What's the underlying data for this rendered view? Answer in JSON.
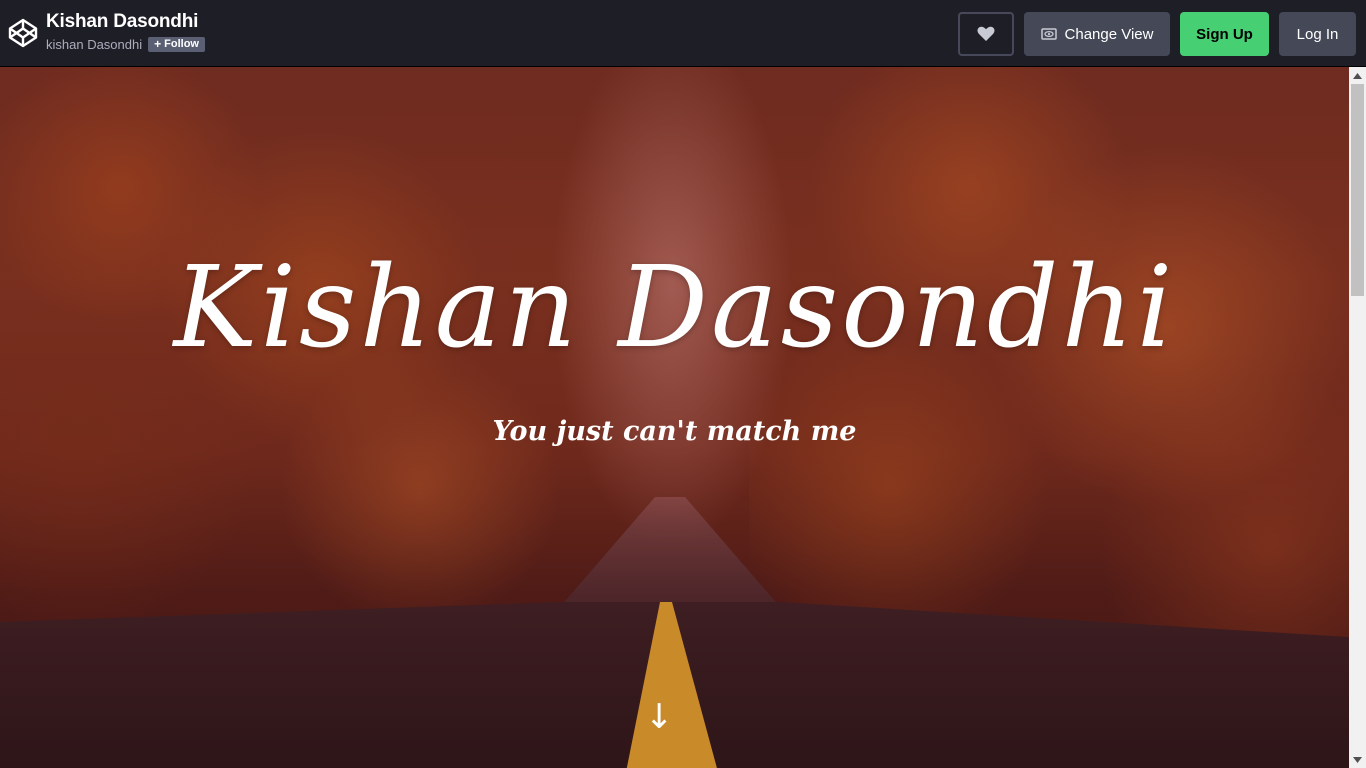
{
  "header": {
    "pen_title": "Kishan Dasondhi",
    "author_name": "kishan Dasondhi",
    "follow_label": "Follow",
    "change_view_label": "Change View",
    "signup_label": "Sign Up",
    "login_label": "Log In"
  },
  "hero": {
    "title": "Kishan Dasondhi",
    "subtitle": "You just can't match me",
    "scroll_arrow": "↓"
  },
  "icons": {
    "logo": "codepen-logo-icon",
    "heart": "heart-icon",
    "view": "eye-icon",
    "follow": "plus-icon"
  },
  "colors": {
    "topbar_bg": "#1e1f26",
    "signup_green": "#47cf73",
    "button_gray": "#444857",
    "follow_gray": "#5a5f73"
  }
}
